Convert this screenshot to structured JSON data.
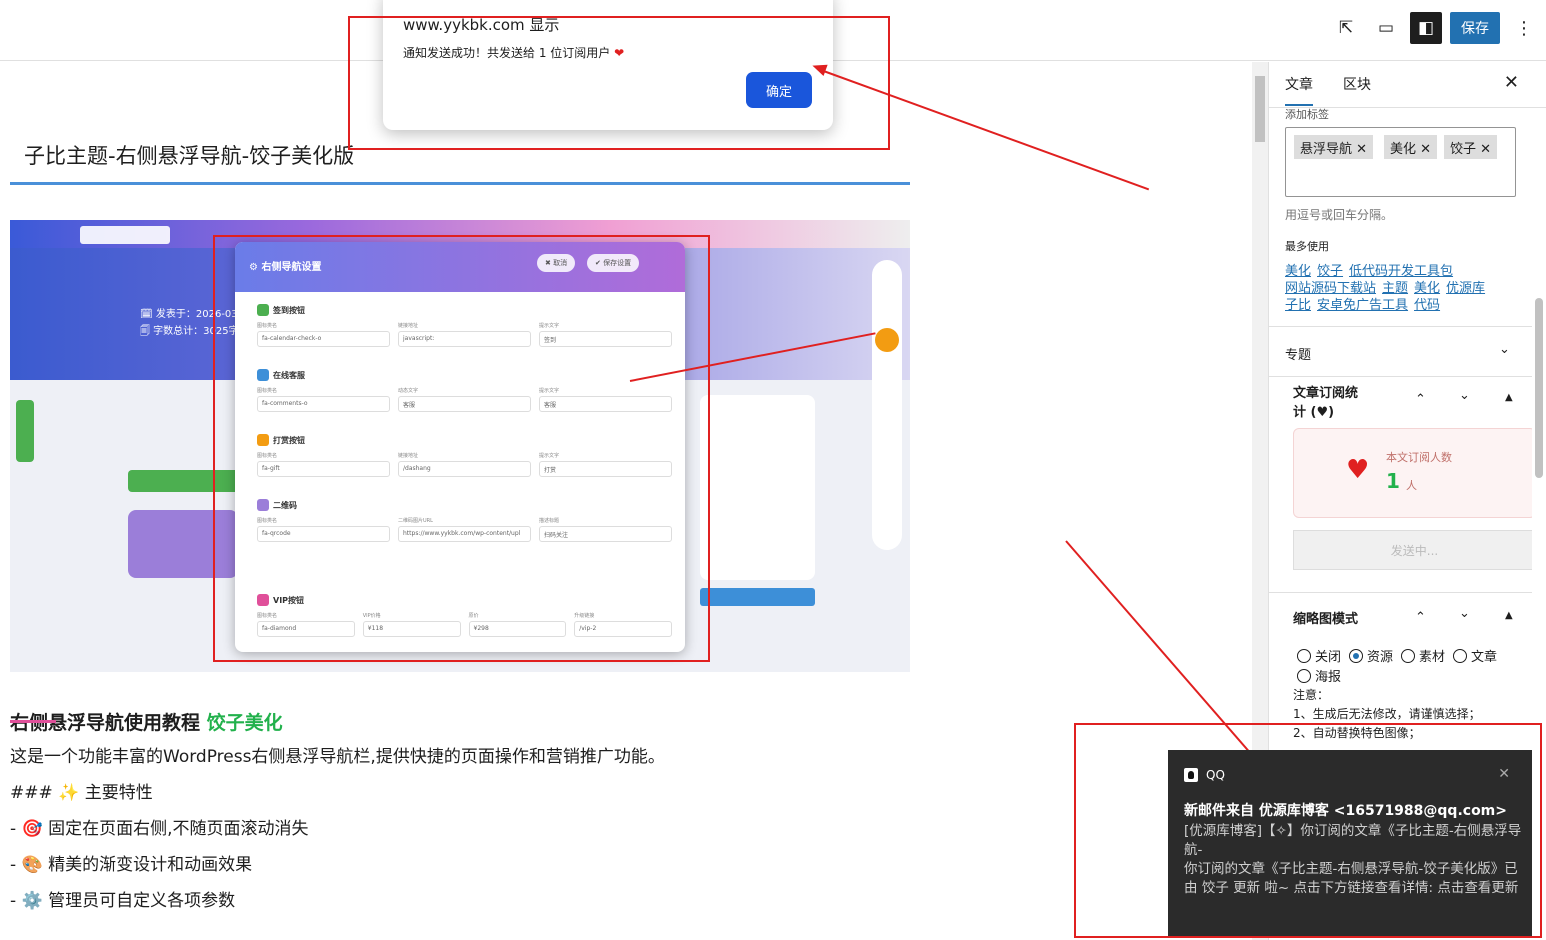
{
  "toolbar": {
    "save_label": "保存"
  },
  "alert": {
    "title": "www.yykbk.com 显示",
    "message": "通知发送成功！共发送给 1 位订阅用户",
    "heart": "❤",
    "ok_label": "确定"
  },
  "editor": {
    "post_title": "子比主题-右侧悬浮导航-饺子美化版",
    "screenshot": {
      "hero_line1": "🗓 发表于：2026-03-",
      "hero_line2": "🗐 字数总计：3025字",
      "modal_title": "⚙ 右侧导航设置",
      "cancel_btn": "✖ 取消",
      "save_btn": "✔ 保存设置",
      "sections": [
        {
          "title": "签到按钮",
          "color": "#4caf50",
          "fields": [
            {
              "label": "图标类名",
              "value": "fa-calendar-check-o"
            },
            {
              "label": "链接地址",
              "value": "javascript:"
            },
            {
              "label": "提示文字",
              "value": "签到"
            }
          ]
        },
        {
          "title": "在线客服",
          "color": "#3d8fd8",
          "fields": [
            {
              "label": "图标类名",
              "value": "fa-comments-o"
            },
            {
              "label": "动态文字",
              "value": "客服"
            },
            {
              "label": "提示文字",
              "value": "客服"
            }
          ]
        },
        {
          "title": "打赏按钮",
          "color": "#f39c12",
          "fields": [
            {
              "label": "图标类名",
              "value": "fa-gift"
            },
            {
              "label": "链接地址",
              "value": "/dashang"
            },
            {
              "label": "提示文字",
              "value": "打赏"
            }
          ]
        },
        {
          "title": "二维码",
          "color": "#9b7ed9",
          "fields": [
            {
              "label": "图标类名",
              "value": "fa-qrcode"
            },
            {
              "label": "二维码图片URL",
              "value": "https://www.yykbk.com/wp-content/upl"
            },
            {
              "label": "描述标题",
              "value": "扫码关注"
            }
          ]
        },
        {
          "title": "VIP按钮",
          "color": "#e0509a",
          "fields": [
            {
              "label": "图标类名",
              "value": "fa-diamond"
            },
            {
              "label": "VIP价格",
              "value": "¥118"
            },
            {
              "label": "原价",
              "value": "¥298"
            },
            {
              "label": "升级链接",
              "value": "/vip-2"
            }
          ]
        }
      ]
    },
    "heading_main": "右侧悬浮导航使用教程",
    "heading_accent": "饺子美化",
    "lines": [
      "这是一个功能丰富的WordPress右侧悬浮导航栏,提供快捷的页面操作和营销推广功能。",
      "### ✨ 主要特性",
      "- 🎯 固定在页面右侧,不随页面滚动消失",
      "- 🎨 精美的渐变设计和动画效果",
      "- ⚙️ 管理员可自定义各项参数"
    ]
  },
  "sidebar": {
    "tabs": [
      "文章",
      "区块"
    ],
    "tag_label": "添加标签",
    "tags": [
      "悬浮导航",
      "美化",
      "饺子"
    ],
    "tag_help": "用逗号或回车分隔。",
    "most_used_label": "最多使用",
    "most_used": [
      [
        "美化",
        "饺子",
        "低代码开发工具包"
      ],
      [
        "网站源码下载站",
        "主题",
        "美化",
        "优源库"
      ],
      [
        "子比",
        "安卓免广告工具",
        "代码"
      ]
    ],
    "topic_panel": "专题",
    "subscribe_panel_line1": "文章订阅统",
    "subscribe_panel_line2": "计 (♥)",
    "subscribe_label": "本文订阅人数",
    "subscribe_count": "1",
    "subscribe_unit": "人",
    "send_btn": "发送中...",
    "thumb_panel": "缩略图模式",
    "radio_options": [
      "关闭",
      "资源",
      "素材",
      "文章"
    ],
    "radio_option_last": "海报",
    "radio_selected": "资源",
    "notes": [
      "注意：",
      "1、生成后无法修改，请谨慎选择；",
      "2、自动替换特色图像；"
    ]
  },
  "toast": {
    "app": "QQ",
    "sender": "新邮件来自 优源库博客 <16571988@qq.com>",
    "body": "[优源库博客]【✧】你订阅的文章《子比主题-右侧悬浮导航-\n你订阅的文章《子比主题-右侧悬浮导航-饺子美化版》已由 饺子 更新 啦~ 点击下方链接查看详情: 点击查看更新"
  }
}
